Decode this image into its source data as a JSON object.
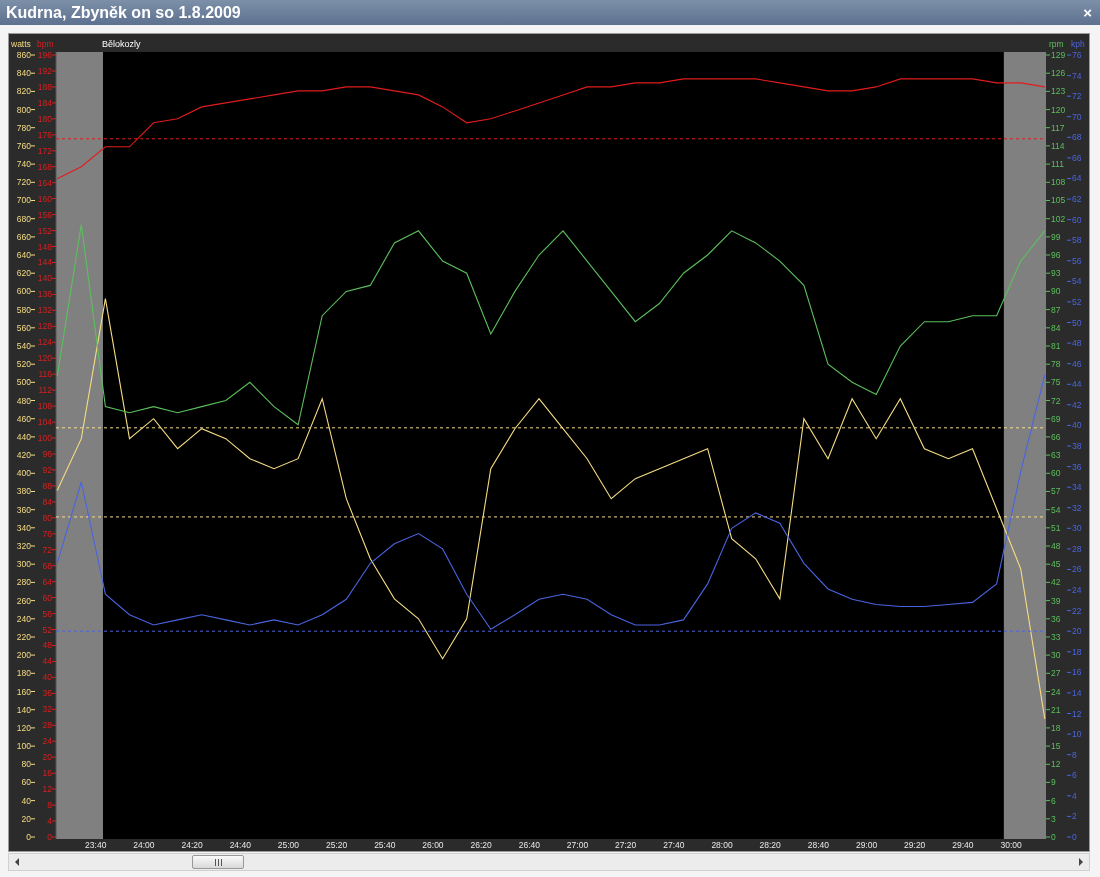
{
  "window": {
    "title": "Kudrna, Zbyněk on so 1.8.2009",
    "close_glyph": "×"
  },
  "chart": {
    "marker_label": "Bělokozly",
    "layers": [
      {
        "chart_data": {
          "type": "line",
          "ylabel": "watts",
          "xlim": [
            1403.5,
            1814.5
          ],
          "ylim": [
            0,
            860
          ],
          "x": [
            1404,
            1414,
            1424,
            1434,
            1444,
            1454,
            1464,
            1474,
            1484,
            1494,
            1504,
            1514,
            1524,
            1534,
            1544,
            1554,
            1564,
            1574,
            1584,
            1594,
            1604,
            1614,
            1624,
            1634,
            1644,
            1654,
            1664,
            1674,
            1684,
            1694,
            1704,
            1714,
            1724,
            1734,
            1744,
            1754,
            1764,
            1774,
            1784,
            1794,
            1804,
            1814
          ],
          "xticks": [
            {
              "value": 1420,
              "label": "23:40"
            },
            {
              "value": 1440,
              "label": "24:00"
            },
            {
              "value": 1460,
              "label": "24:20"
            },
            {
              "value": 1480,
              "label": "24:40"
            },
            {
              "value": 1500,
              "label": "25:00"
            },
            {
              "value": 1520,
              "label": "25:20"
            },
            {
              "value": 1540,
              "label": "25:40"
            },
            {
              "value": 1560,
              "label": "26:00"
            },
            {
              "value": 1580,
              "label": "26:20"
            },
            {
              "value": 1600,
              "label": "26:40"
            },
            {
              "value": 1620,
              "label": "27:00"
            },
            {
              "value": 1640,
              "label": "27:20"
            },
            {
              "value": 1660,
              "label": "27:40"
            },
            {
              "value": 1680,
              "label": "28:00"
            },
            {
              "value": 1700,
              "label": "28:20"
            },
            {
              "value": 1720,
              "label": "28:40"
            },
            {
              "value": 1740,
              "label": "29:00"
            },
            {
              "value": 1760,
              "label": "29:20"
            },
            {
              "value": 1780,
              "label": "29:40"
            },
            {
              "value": 1800,
              "label": "30:00"
            }
          ],
          "yticks": [
            0,
            20,
            40,
            60,
            80,
            100,
            120,
            140,
            160,
            180,
            200,
            220,
            240,
            260,
            280,
            300,
            320,
            340,
            360,
            380,
            400,
            420,
            440,
            460,
            480,
            500,
            520,
            540,
            560,
            580,
            600,
            620,
            640,
            660,
            680,
            700,
            720,
            740,
            760,
            780,
            800,
            820,
            840,
            860
          ],
          "series": [
            {
              "color": "#f5dc82",
              "values": [
                381,
                438,
                592,
                438,
                460,
                427,
                449,
                438,
                416,
                405,
                416,
                482,
                372,
                306,
                262,
                240,
                196,
                240,
                405,
                449,
                482,
                449,
                416,
                372,
                394,
                405,
                416,
                427,
                328,
                306,
                262,
                460,
                416,
                482,
                438,
                482,
                427,
                416,
                427,
                361,
                295,
                130
              ]
            }
          ],
          "bands": [
            {
              "axis": "x",
              "from": 1403.5,
              "to": 1423
            },
            {
              "axis": "x",
              "from": 1797,
              "to": 1814.5
            }
          ],
          "ref_lines": [
            {
              "axis": "y",
              "value": 450
            },
            {
              "axis": "y",
              "value": 352
            }
          ]
        }
      },
      {
        "chart_data": {
          "type": "line",
          "ylabel": "bpm",
          "ylim": [
            0,
            196
          ],
          "yticks": [
            0,
            4,
            8,
            12,
            16,
            20,
            24,
            28,
            32,
            36,
            40,
            44,
            48,
            52,
            56,
            60,
            64,
            68,
            72,
            76,
            80,
            84,
            88,
            92,
            96,
            100,
            104,
            108,
            112,
            116,
            120,
            124,
            128,
            132,
            136,
            140,
            144,
            148,
            152,
            156,
            160,
            164,
            168,
            172,
            176,
            180,
            184,
            188,
            192,
            196
          ],
          "series": [
            {
              "color": "#e01c1c",
              "values": [
                165,
                168,
                173,
                173,
                179,
                180,
                183,
                184,
                185,
                186,
                187,
                187,
                188,
                188,
                187,
                186,
                183,
                179,
                180,
                182,
                184,
                186,
                188,
                188,
                189,
                189,
                190,
                190,
                190,
                190,
                189,
                188,
                187,
                187,
                188,
                190,
                190,
                190,
                190,
                189,
                189,
                188
              ]
            }
          ],
          "ref_lines": [
            {
              "axis": "y",
              "value": 175
            }
          ]
        }
      },
      {
        "chart_data": {
          "type": "line",
          "ylabel": "rpm",
          "ylim": [
            0,
            129
          ],
          "yticks": [
            0,
            3,
            6,
            9,
            12,
            15,
            18,
            21,
            24,
            27,
            30,
            33,
            36,
            39,
            42,
            45,
            48,
            51,
            54,
            57,
            60,
            63,
            66,
            69,
            72,
            75,
            78,
            81,
            84,
            87,
            90,
            93,
            96,
            99,
            102,
            105,
            108,
            111,
            114,
            117,
            120,
            123,
            126,
            129
          ],
          "series": [
            {
              "color": "#5cbf5c",
              "values": [
                76,
                101,
                71,
                70,
                71,
                70,
                71,
                72,
                75,
                71,
                68,
                86,
                90,
                91,
                98,
                100,
                95,
                93,
                83,
                90,
                96,
                100,
                95,
                90,
                85,
                88,
                93,
                96,
                100,
                98,
                95,
                91,
                78,
                75,
                73,
                81,
                85,
                85,
                86,
                86,
                95,
                100
              ]
            }
          ]
        }
      },
      {
        "chart_data": {
          "type": "line",
          "ylabel": "kph",
          "ylim": [
            0,
            76
          ],
          "yticks": [
            0,
            2,
            4,
            6,
            8,
            10,
            12,
            14,
            16,
            18,
            20,
            22,
            24,
            26,
            28,
            30,
            32,
            34,
            36,
            38,
            40,
            42,
            44,
            46,
            48,
            50,
            52,
            54,
            56,
            58,
            60,
            62,
            64,
            66,
            68,
            70,
            72,
            74,
            76
          ],
          "series": [
            {
              "color": "#4a64e0",
              "values": [
                26.6,
                34.5,
                23.6,
                21.6,
                20.6,
                21.1,
                21.6,
                21.1,
                20.6,
                21.1,
                20.6,
                21.6,
                23.1,
                26.6,
                28.5,
                29.5,
                28.0,
                23.6,
                20.2,
                21.6,
                23.1,
                23.6,
                23.1,
                21.6,
                20.6,
                20.6,
                21.1,
                24.6,
                30.0,
                31.5,
                30.5,
                26.6,
                24.1,
                23.1,
                22.6,
                22.4,
                22.4,
                22.6,
                22.8,
                24.6,
                35.5,
                44.9
              ]
            }
          ],
          "ref_lines": [
            {
              "axis": "y",
              "value": 20
            }
          ]
        }
      }
    ]
  }
}
